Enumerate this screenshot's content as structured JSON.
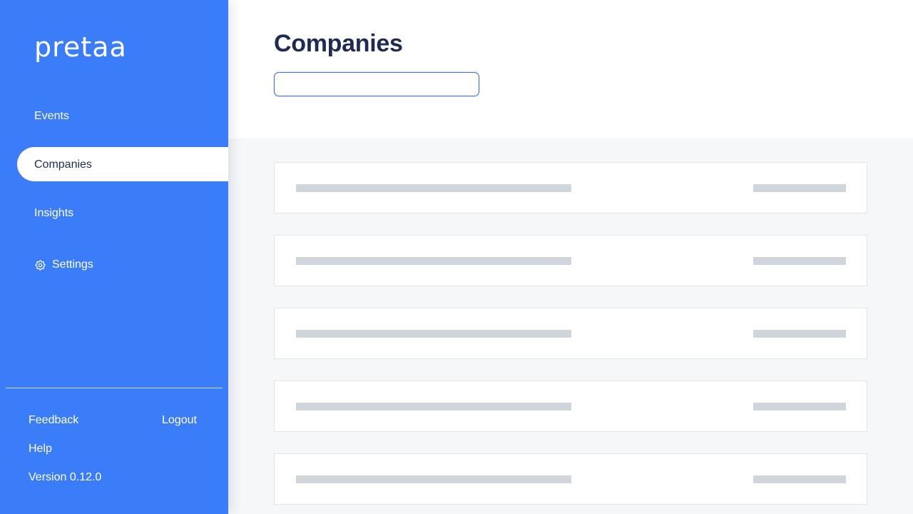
{
  "brand": {
    "logo_text": "pretaa",
    "accent": "#3b7df8",
    "title_color": "#1f2a55"
  },
  "nav": {
    "events": "Events",
    "companies": "Companies",
    "insights": "Insights",
    "settings": "Settings",
    "active": "Companies"
  },
  "footer": {
    "feedback": "Feedback",
    "logout": "Logout",
    "help": "Help",
    "version": "Version 0.12.0"
  },
  "main": {
    "title": "Companies",
    "search": {
      "value": "",
      "placeholder": ""
    },
    "skeleton_rows": 5,
    "state": "loading"
  }
}
